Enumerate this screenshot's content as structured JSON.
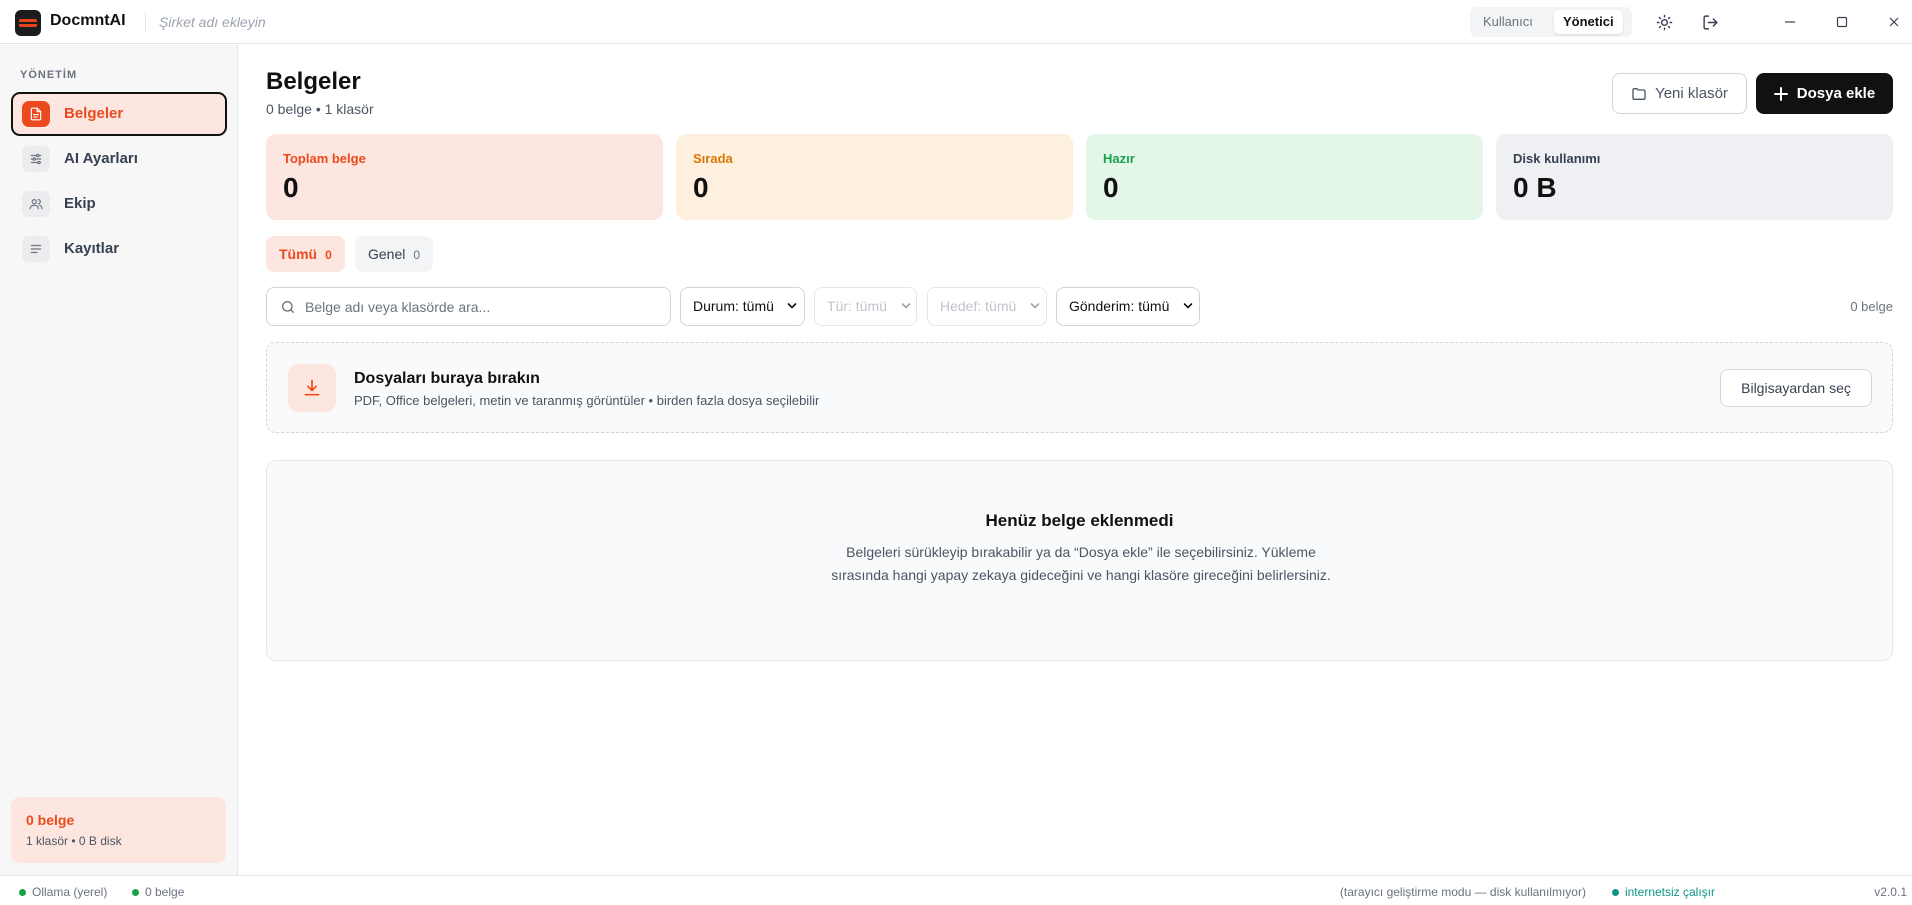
{
  "app": {
    "name": "DocmntAI",
    "company_placeholder": "Şirket adı ekleyin"
  },
  "mode_toggle": {
    "user_label": "Kullanıcı",
    "admin_label": "Yönetici",
    "selected": "Yönetici"
  },
  "sidebar": {
    "section": "YÖNETİM",
    "items": [
      {
        "label": "Belgeler",
        "icon": "document-icon",
        "active": true
      },
      {
        "label": "AI Ayarları",
        "icon": "sliders-icon",
        "active": false
      },
      {
        "label": "Ekip",
        "icon": "users-icon",
        "active": false
      },
      {
        "label": "Kayıtlar",
        "icon": "list-icon",
        "active": false
      }
    ],
    "footer": {
      "title": "0 belge",
      "detail": "1 klasör • 0 B disk"
    }
  },
  "header": {
    "title": "Belgeler",
    "subtitle": "0 belge • 1 klasör",
    "new_folder_label": "Yeni klasör",
    "add_file_label": "Dosya ekle"
  },
  "stats": [
    {
      "label": "Toplam belge",
      "value": "0",
      "bg": "#fde6df",
      "color": "#ea4a1d"
    },
    {
      "label": "Sırada",
      "value": "0",
      "bg": "#fdf0de",
      "color": "#d97706"
    },
    {
      "label": "Hazır",
      "value": "0",
      "bg": "#e3f6e8",
      "color": "#16a34a"
    },
    {
      "label": "Disk kullanımı",
      "value": "0 B",
      "bg": "#eef0f3",
      "color": "#374151"
    }
  ],
  "tabs": [
    {
      "label": "Tümü",
      "count": "0",
      "active": true
    },
    {
      "label": "Genel",
      "count": "0",
      "active": false
    }
  ],
  "filters": {
    "search_placeholder": "Belge adı veya klasörde ara...",
    "status": "Durum: tümü",
    "type": "Tür: tümü",
    "target": "Hedef: tümü",
    "sending": "Gönderim: tümü",
    "doc_count": "0 belge"
  },
  "dropzone": {
    "title": "Dosyaları buraya bırakın",
    "description": "PDF, Office belgeleri, metin ve taranmış görüntüler • birden fazla dosya seçilebilir",
    "button_label": "Bilgisayardan seç"
  },
  "empty_state": {
    "title": "Henüz belge eklenmedi",
    "description": "Belgeleri sürükleyip bırakabilir ya da “Dosya ekle” ile seçebilirsiniz. Yükleme sırasında hangi yapay zekaya gideceğini ve hangi klasöre gireceğini belirlersiniz."
  },
  "statusbar": {
    "engine": "Ollama (yerel)",
    "docs": "0 belge",
    "dev_note": "(tarayıcı geliştirme modu — disk kullanılmıyor)",
    "offline": "internetsiz çalışır",
    "version": "v2.0.1"
  },
  "colors": {
    "accent": "#ea4a1d",
    "accent_soft": "#fde6df",
    "ok": "#16a34a"
  }
}
